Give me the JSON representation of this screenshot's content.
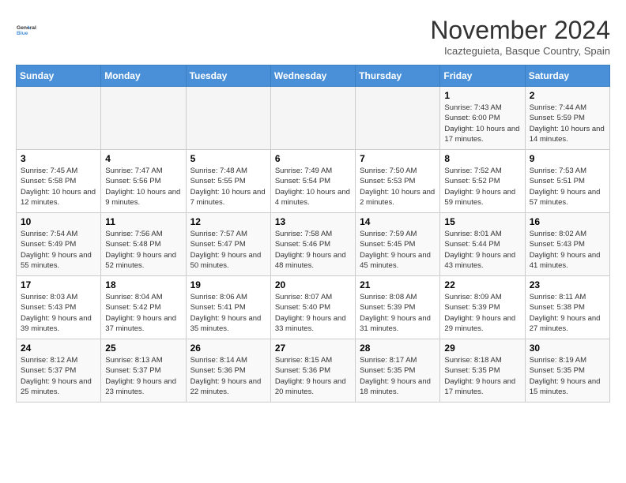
{
  "logo": {
    "line1": "General",
    "line2": "Blue"
  },
  "title": "November 2024",
  "subtitle": "Icazteguieta, Basque Country, Spain",
  "weekdays": [
    "Sunday",
    "Monday",
    "Tuesday",
    "Wednesday",
    "Thursday",
    "Friday",
    "Saturday"
  ],
  "weeks": [
    [
      {
        "day": "",
        "info": ""
      },
      {
        "day": "",
        "info": ""
      },
      {
        "day": "",
        "info": ""
      },
      {
        "day": "",
        "info": ""
      },
      {
        "day": "",
        "info": ""
      },
      {
        "day": "1",
        "info": "Sunrise: 7:43 AM\nSunset: 6:00 PM\nDaylight: 10 hours and 17 minutes."
      },
      {
        "day": "2",
        "info": "Sunrise: 7:44 AM\nSunset: 5:59 PM\nDaylight: 10 hours and 14 minutes."
      }
    ],
    [
      {
        "day": "3",
        "info": "Sunrise: 7:45 AM\nSunset: 5:58 PM\nDaylight: 10 hours and 12 minutes."
      },
      {
        "day": "4",
        "info": "Sunrise: 7:47 AM\nSunset: 5:56 PM\nDaylight: 10 hours and 9 minutes."
      },
      {
        "day": "5",
        "info": "Sunrise: 7:48 AM\nSunset: 5:55 PM\nDaylight: 10 hours and 7 minutes."
      },
      {
        "day": "6",
        "info": "Sunrise: 7:49 AM\nSunset: 5:54 PM\nDaylight: 10 hours and 4 minutes."
      },
      {
        "day": "7",
        "info": "Sunrise: 7:50 AM\nSunset: 5:53 PM\nDaylight: 10 hours and 2 minutes."
      },
      {
        "day": "8",
        "info": "Sunrise: 7:52 AM\nSunset: 5:52 PM\nDaylight: 9 hours and 59 minutes."
      },
      {
        "day": "9",
        "info": "Sunrise: 7:53 AM\nSunset: 5:51 PM\nDaylight: 9 hours and 57 minutes."
      }
    ],
    [
      {
        "day": "10",
        "info": "Sunrise: 7:54 AM\nSunset: 5:49 PM\nDaylight: 9 hours and 55 minutes."
      },
      {
        "day": "11",
        "info": "Sunrise: 7:56 AM\nSunset: 5:48 PM\nDaylight: 9 hours and 52 minutes."
      },
      {
        "day": "12",
        "info": "Sunrise: 7:57 AM\nSunset: 5:47 PM\nDaylight: 9 hours and 50 minutes."
      },
      {
        "day": "13",
        "info": "Sunrise: 7:58 AM\nSunset: 5:46 PM\nDaylight: 9 hours and 48 minutes."
      },
      {
        "day": "14",
        "info": "Sunrise: 7:59 AM\nSunset: 5:45 PM\nDaylight: 9 hours and 45 minutes."
      },
      {
        "day": "15",
        "info": "Sunrise: 8:01 AM\nSunset: 5:44 PM\nDaylight: 9 hours and 43 minutes."
      },
      {
        "day": "16",
        "info": "Sunrise: 8:02 AM\nSunset: 5:43 PM\nDaylight: 9 hours and 41 minutes."
      }
    ],
    [
      {
        "day": "17",
        "info": "Sunrise: 8:03 AM\nSunset: 5:43 PM\nDaylight: 9 hours and 39 minutes."
      },
      {
        "day": "18",
        "info": "Sunrise: 8:04 AM\nSunset: 5:42 PM\nDaylight: 9 hours and 37 minutes."
      },
      {
        "day": "19",
        "info": "Sunrise: 8:06 AM\nSunset: 5:41 PM\nDaylight: 9 hours and 35 minutes."
      },
      {
        "day": "20",
        "info": "Sunrise: 8:07 AM\nSunset: 5:40 PM\nDaylight: 9 hours and 33 minutes."
      },
      {
        "day": "21",
        "info": "Sunrise: 8:08 AM\nSunset: 5:39 PM\nDaylight: 9 hours and 31 minutes."
      },
      {
        "day": "22",
        "info": "Sunrise: 8:09 AM\nSunset: 5:39 PM\nDaylight: 9 hours and 29 minutes."
      },
      {
        "day": "23",
        "info": "Sunrise: 8:11 AM\nSunset: 5:38 PM\nDaylight: 9 hours and 27 minutes."
      }
    ],
    [
      {
        "day": "24",
        "info": "Sunrise: 8:12 AM\nSunset: 5:37 PM\nDaylight: 9 hours and 25 minutes."
      },
      {
        "day": "25",
        "info": "Sunrise: 8:13 AM\nSunset: 5:37 PM\nDaylight: 9 hours and 23 minutes."
      },
      {
        "day": "26",
        "info": "Sunrise: 8:14 AM\nSunset: 5:36 PM\nDaylight: 9 hours and 22 minutes."
      },
      {
        "day": "27",
        "info": "Sunrise: 8:15 AM\nSunset: 5:36 PM\nDaylight: 9 hours and 20 minutes."
      },
      {
        "day": "28",
        "info": "Sunrise: 8:17 AM\nSunset: 5:35 PM\nDaylight: 9 hours and 18 minutes."
      },
      {
        "day": "29",
        "info": "Sunrise: 8:18 AM\nSunset: 5:35 PM\nDaylight: 9 hours and 17 minutes."
      },
      {
        "day": "30",
        "info": "Sunrise: 8:19 AM\nSunset: 5:35 PM\nDaylight: 9 hours and 15 minutes."
      }
    ]
  ]
}
